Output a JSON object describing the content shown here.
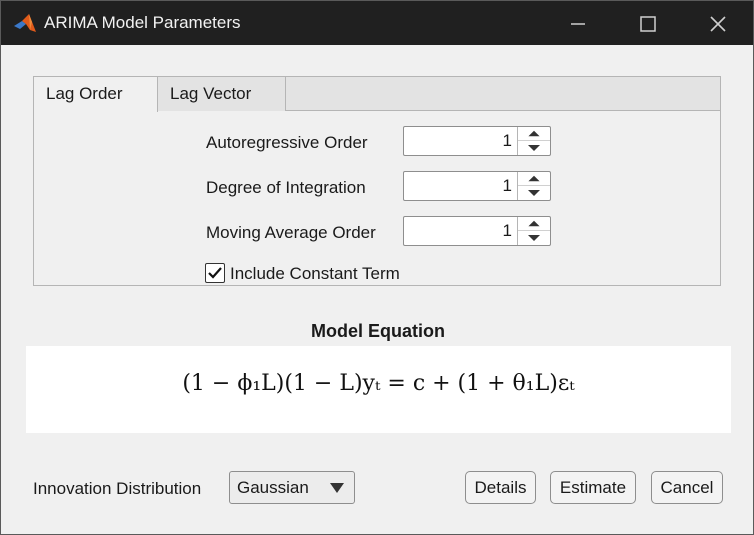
{
  "window": {
    "title": "ARIMA Model Parameters",
    "icon": "matlab-icon",
    "controls": [
      "minimize-icon",
      "maximize-icon",
      "close-icon"
    ]
  },
  "tabs": [
    {
      "label": "Lag Order",
      "selected": true
    },
    {
      "label": "Lag Vector",
      "selected": false
    }
  ],
  "parameters": [
    {
      "label": "Autoregressive Order",
      "value": "1"
    },
    {
      "label": "Degree of Integration",
      "value": "1"
    },
    {
      "label": "Moving Average Order",
      "value": "1"
    }
  ],
  "constant_term": {
    "label": "Include Constant Term",
    "checked": true
  },
  "equation": {
    "heading": "Model Equation",
    "text": "(1 − ϕ₁L)(1 − L)yₜ = c + (1 + θ₁L)εₜ"
  },
  "innovation": {
    "label": "Innovation Distribution",
    "selected": "Gaussian"
  },
  "buttons": {
    "details": "Details",
    "estimate": "Estimate",
    "cancel": "Cancel"
  },
  "colors": {
    "titlebar": "#202020",
    "accent": "#1f6fd1"
  }
}
